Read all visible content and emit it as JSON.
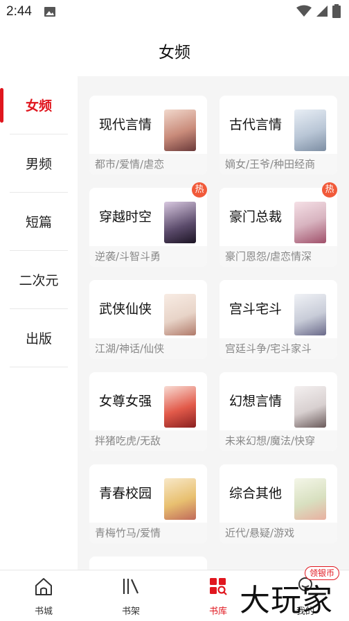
{
  "status_bar": {
    "time": "2:44"
  },
  "header": {
    "title": "女频"
  },
  "sidebar": {
    "items": [
      {
        "label": "女频",
        "active": true
      },
      {
        "label": "男频",
        "active": false
      },
      {
        "label": "短篇",
        "active": false
      },
      {
        "label": "二次元",
        "active": false
      },
      {
        "label": "出版",
        "active": false
      }
    ]
  },
  "categories": [
    {
      "title": "现代言情",
      "tags": "都市/爱情/虐恋",
      "hot": false,
      "cover_color": "#c98b7a"
    },
    {
      "title": "古代言情",
      "tags": "嫡女/王爷/种田经商",
      "hot": false,
      "cover_color": "#b9c6d6"
    },
    {
      "title": "穿越时空",
      "tags": "逆袭/斗智斗勇",
      "hot": true,
      "hot_label": "热",
      "cover_color": "#5a4a6a"
    },
    {
      "title": "豪门总裁",
      "tags": "豪门恩怨/虐恋情深",
      "hot": true,
      "hot_label": "热",
      "cover_color": "#d8b4c0"
    },
    {
      "title": "武侠仙侠",
      "tags": "江湖/神话/仙侠",
      "hot": false,
      "cover_color": "#e8d4c8"
    },
    {
      "title": "宫斗宅斗",
      "tags": "宫廷斗争/宅斗家斗",
      "hot": false,
      "cover_color": "#c8ccd8"
    },
    {
      "title": "女尊女强",
      "tags": "拌猪吃虎/无敌",
      "hot": false,
      "cover_color": "#e25a4a"
    },
    {
      "title": "幻想言情",
      "tags": "未来幻想/魔法/快穿",
      "hot": false,
      "cover_color": "#d8d0d0"
    },
    {
      "title": "青春校园",
      "tags": "青梅竹马/爱情",
      "hot": false,
      "cover_color": "#e8c070"
    },
    {
      "title": "综合其他",
      "tags": "近代/悬疑/游戏",
      "hot": false,
      "cover_color": "#d8e0c0"
    }
  ],
  "bottom_nav": {
    "items": [
      {
        "label": "书城",
        "icon": "house-icon",
        "active": false
      },
      {
        "label": "书架",
        "icon": "bookshelf-icon",
        "active": false
      },
      {
        "label": "书库",
        "icon": "library-grid-icon",
        "active": true
      },
      {
        "label": "我的",
        "icon": "profile-icon",
        "active": false
      }
    ],
    "reward_badge": "领银币"
  },
  "watermark": "大玩家",
  "colors": {
    "accent": "#e0161e",
    "hot": "#f15a3a",
    "content_bg": "#f5f5f5"
  }
}
